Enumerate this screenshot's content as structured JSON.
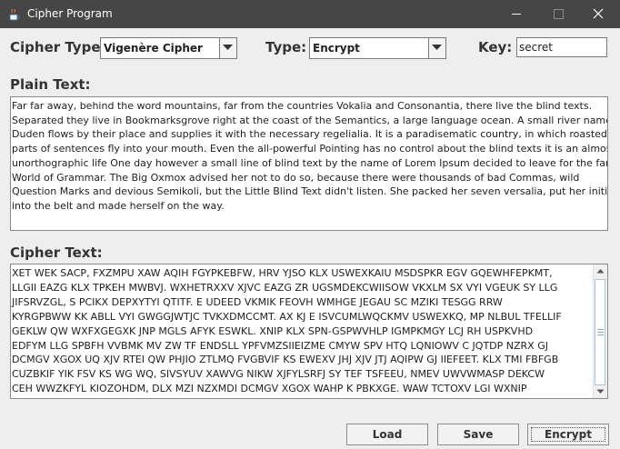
{
  "window": {
    "title": "Cipher Program",
    "icon": "java-cup-icon",
    "title_bar_color": "#464646"
  },
  "controls": {
    "cipher_type_label": "Cipher Type:",
    "cipher_type_value": "Vigenère Cipher",
    "mode_label": "Type:",
    "mode_value": "Encrypt",
    "key_label": "Key:",
    "key_value": "secret"
  },
  "plain": {
    "label": "Plain Text:",
    "text": "Far far away, behind the word mountains, far from the countries Vokalia and Consonantia, there live the blind texts.\nSeparated they live in Bookmarksgrove right at the coast of the Semantics, a large language ocean. A small river named\nDuden flows by their place and supplies it with the necessary regelialia. It is a paradisematic country, in which roasted\nparts of sentences fly into your mouth. Even the all-powerful Pointing has no control about the blind texts it is an almost\nunorthographic life One day however a small line of blind text by the name of Lorem Ipsum decided to leave for the far\nWorld of Grammar. The Big Oxmox advised her not to do so, because there were thousands of bad Commas, wild\nQuestion Marks and devious Semikoli, but the Little Blind Text didn't listen. She packed her seven versalia, put her initial\ninto the belt and made herself on the way."
  },
  "cipher": {
    "label": "Cipher Text:",
    "text": "XET WEK SACP, FXZMPU XAW AQIH FGYPKEBFW, HRV YJSO KLX USWEXKAIU MSDSPKR EGV GQEWHFEPKMT,\nLLGII EAZG KLX TPKEH MWBVJ. WXHETRXXV XJVC EAZG ZR UGSMDEKCWIISOW VKXLM SX VYI VGEUK SY LLG\nJIFSRVZGL, S PCIKX DEPXYTYI QTITF. E UDEED VKMIK FEOVH WMHGE JEGAU SC MZIKI TESGG RRW\nKYRGPBWW KK ABLL VYI GWGGJWTJC TVKXDMCCMT. AX KJ E ISVCUMLWQCKMV USWEXKQ, MP NLBUL TFELLIF\nGEKLW QW WXFXGEGXK JNP MGLS AFYK ESWKL. XNIP KLX SPN-GSPWVHLP IGMPKMGY LCJ RH USPKVHD\nEDFYM LLG SPBFH VVBMK MV ZW TF ENDSLL YPFVMZSIIEIZME CMYW SPV HTQ LQNIOWV C JQTDP NZRX GJ\nDCMGV XGOX UQ XJV RTEI QW PHJIO ZTLMQ FVGBVIF KS EWEXV JHJ XJV JTJ AQIPW GJ IIEFEET. KLX TMI FBFGB\nCUZBKIF YIK FSV KS WG WQ, SIVSYUV XAWVG NIKW XJFYLSRFJ SY TEF TSFEEU, NMEV UWVWMASP DEKCW\nCEH WWZKFYL KIOZOHDM, DLX MZI NZXMDI DCMGV XGOX WAHP K PBKXGE. WAW TCTOXV LGI WXNIP"
  },
  "buttons": {
    "load": "Load",
    "save": "Save",
    "encrypt": "Encrypt"
  }
}
